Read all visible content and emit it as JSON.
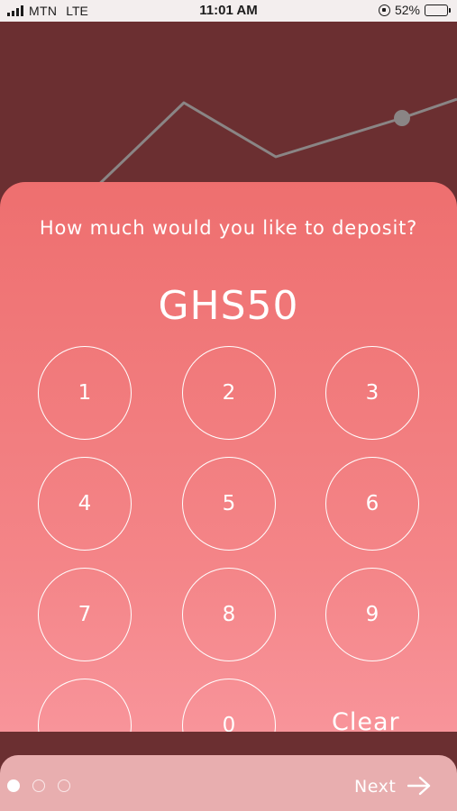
{
  "status_bar": {
    "carrier": "MTN",
    "network": "LTE",
    "time": "11:01 AM",
    "battery": "52%",
    "battery_level": 0.52,
    "icons": [
      "signal-icon",
      "lock-rotation-icon",
      "battery-icon"
    ]
  },
  "deposit": {
    "question": "How much would you like to deposit?",
    "amount": "GHS50"
  },
  "keypad": {
    "keys": [
      {
        "label": "1"
      },
      {
        "label": "2"
      },
      {
        "label": "3"
      },
      {
        "label": "4"
      },
      {
        "label": "5"
      },
      {
        "label": "6"
      },
      {
        "label": "7"
      },
      {
        "label": "8"
      },
      {
        "label": "9"
      },
      {
        "label": ""
      },
      {
        "label": "0"
      }
    ],
    "clear_label": "Clear"
  },
  "footer": {
    "page_indicator": {
      "current": 1,
      "total": 3
    },
    "next_label": "Next",
    "next_icon": "arrow-right-icon"
  },
  "colors": {
    "background_dark": "#6b2f31",
    "sheet_top": "#ee6f6f",
    "sheet_bottom": "#f8949a",
    "footer": "#e8aeaf",
    "text": "#ffffff"
  }
}
